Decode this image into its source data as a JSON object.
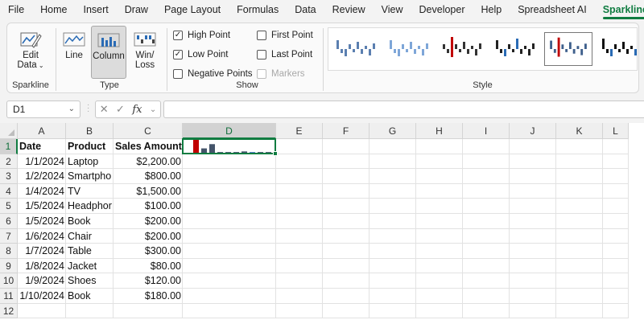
{
  "menu": {
    "items": [
      "File",
      "Home",
      "Insert",
      "Draw",
      "Page Layout",
      "Formulas",
      "Data",
      "Review",
      "View",
      "Developer",
      "Help",
      "Spreadsheet AI",
      "Sparkline"
    ],
    "active": "Sparkline",
    "accent_color": "#107c41"
  },
  "ribbon": {
    "sparkline_group": {
      "edit_data_label_1": "Edit",
      "edit_data_label_2": "Data",
      "group_label": "Sparkline"
    },
    "type_group": {
      "line_label": "Line",
      "column_label": "Column",
      "winloss_label_1": "Win/",
      "winloss_label_2": "Loss",
      "group_label": "Type",
      "selected": "Column"
    },
    "show_group": {
      "high_point": {
        "label": "High Point",
        "checked": true
      },
      "low_point": {
        "label": "Low Point",
        "checked": true
      },
      "negative_points": {
        "label": "Negative Points",
        "checked": false
      },
      "first_point": {
        "label": "First Point",
        "checked": false
      },
      "last_point": {
        "label": "Last Point",
        "checked": false
      },
      "markers": {
        "label": "Markers",
        "checked": false,
        "disabled": true
      },
      "group_label": "Show"
    },
    "style_group": {
      "group_label": "Style",
      "selected_index": 4
    }
  },
  "formula_bar": {
    "name_box": "D1",
    "fx_label": "fx",
    "formula": ""
  },
  "grid": {
    "columns": [
      "A",
      "B",
      "C",
      "D",
      "E",
      "F",
      "G",
      "H",
      "I",
      "J",
      "K",
      "L"
    ],
    "rows": [
      "1",
      "2",
      "3",
      "4",
      "5",
      "6",
      "7",
      "8",
      "9",
      "10",
      "11",
      "12"
    ],
    "selected_column": "D",
    "selected_row": "1",
    "headers": {
      "a": "Date",
      "b": "Product",
      "c": "Sales Amount"
    },
    "data": [
      {
        "date": "1/1/2024",
        "product": "Laptop",
        "amount": "$2,200.00"
      },
      {
        "date": "1/2/2024",
        "product": "Smartpho",
        "amount": "$800.00"
      },
      {
        "date": "1/4/2024",
        "product": "TV",
        "amount": "$1,500.00"
      },
      {
        "date": "1/5/2024",
        "product": "Headphor",
        "amount": "$100.00"
      },
      {
        "date": "1/5/2024",
        "product": "Book",
        "amount": "$200.00"
      },
      {
        "date": "1/6/2024",
        "product": "Chair",
        "amount": "$200.00"
      },
      {
        "date": "1/7/2024",
        "product": "Table",
        "amount": "$300.00"
      },
      {
        "date": "1/8/2024",
        "product": "Jacket",
        "amount": "$80.00"
      },
      {
        "date": "1/9/2024",
        "product": "Shoes",
        "amount": "$120.00"
      },
      {
        "date": "1/10/2024",
        "product": "Book",
        "amount": "$180.00"
      }
    ]
  },
  "sparkline": {
    "type": "column",
    "values": [
      2200,
      800,
      1500,
      100,
      200,
      200,
      300,
      80,
      120,
      180
    ],
    "high_color": "#c00000",
    "low_color": "#4472c4",
    "bar_color": "#44546a"
  }
}
